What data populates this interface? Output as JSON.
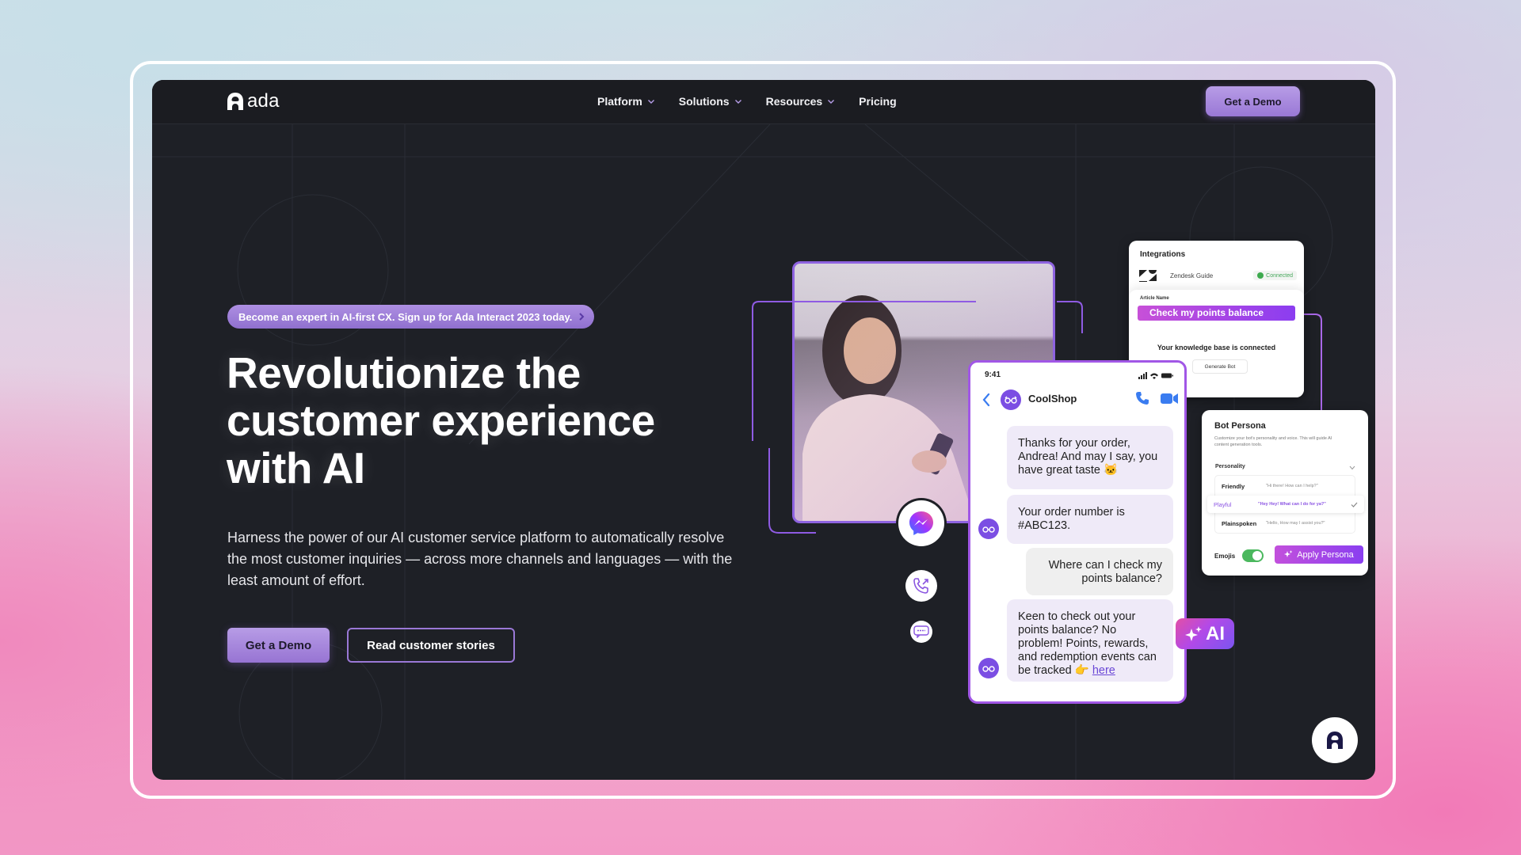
{
  "nav": {
    "logo_text": "ada",
    "links": [
      {
        "label": "Platform",
        "has_dropdown": true
      },
      {
        "label": "Solutions",
        "has_dropdown": true
      },
      {
        "label": "Resources",
        "has_dropdown": true
      },
      {
        "label": "Pricing",
        "has_dropdown": false
      }
    ],
    "cta_label": "Get a Demo"
  },
  "hero": {
    "announcement": "Become an expert in AI-first CX. Sign up for Ada Interact 2023 today.",
    "headline_lines": [
      "Revolutionize the",
      "customer experience",
      "with AI"
    ],
    "subcopy": "Harness the power of our AI customer service platform to automatically resolve the most customer inquiries — across more channels and languages — with the least amount of effort.",
    "primary_cta": "Get a Demo",
    "secondary_cta": "Read customer stories"
  },
  "integrations_card": {
    "title": "Integrations",
    "integration_name": "Zendesk Guide",
    "status": "Connected",
    "article_label": "Article Name",
    "article_value": "Check my points balance",
    "kb_status": "Your knowledge base is connected",
    "generate_button": "Generate Bot"
  },
  "phone": {
    "time": "9:41",
    "contact_name": "CoolShop",
    "messages": [
      {
        "from": "bot",
        "text": "Thanks for your order, Andrea! And may I say, you have great taste 🐱"
      },
      {
        "from": "bot",
        "text": "Your order number is #ABC123."
      },
      {
        "from": "user",
        "text": "Where can I check my points balance?"
      },
      {
        "from": "bot",
        "text": "Keen to check out your points balance? No problem! Points, rewards, and redemption events can be tracked 👉 ",
        "link": "here"
      }
    ]
  },
  "persona_card": {
    "title": "Bot Persona",
    "description": "Customize your bot's personality and voice. This will guide AI content generation tools.",
    "personality_label": "Personality",
    "options": [
      {
        "name": "Friendly",
        "quote": "\"Hi there! How can I help?\"",
        "selected": false
      },
      {
        "name": "Playful",
        "quote": "\"Hey Hey! What can I do for ya?\"",
        "selected": true
      },
      {
        "name": "Plainspoken",
        "quote": "\"Hello, How may I assist you?\"",
        "selected": false
      }
    ],
    "emojis_label": "Emojis",
    "emojis_enabled": true,
    "apply_button": "Apply Persona"
  },
  "ai_badge": "AI",
  "channels": [
    "messenger-icon",
    "phone-call-icon",
    "sms-icon"
  ],
  "colors": {
    "brand_purple": "#9a78d6",
    "accent_gradient_start": "#c750d8",
    "accent_gradient_end": "#8b3df0",
    "panel_bg": "#1e2026"
  }
}
